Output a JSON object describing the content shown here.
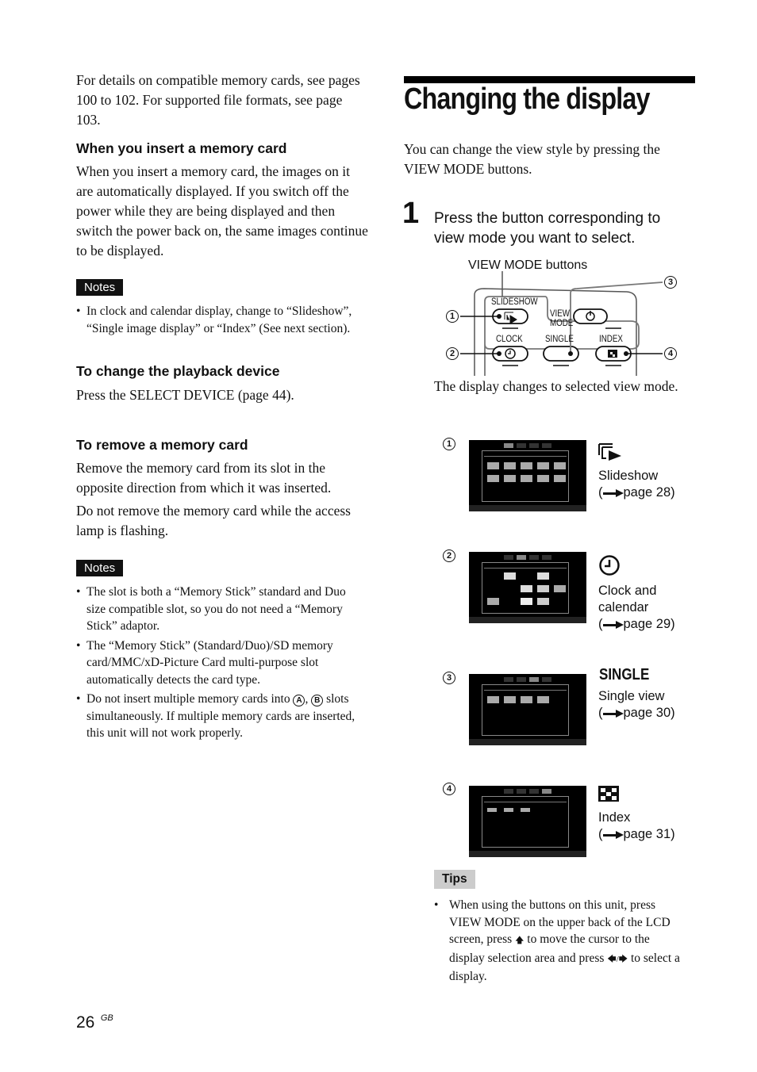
{
  "left": {
    "intro": "For details on compatible memory cards, see pages 100 to 102. For supported file formats, see page 103.",
    "section1": {
      "heading": "When you insert a memory card",
      "body": "When you insert a memory card, the images on it are automatically displayed. If you switch off the power while they are being displayed and then switch the power back on, the same images continue to be displayed."
    },
    "notes1": {
      "label": "Notes",
      "items": [
        "In clock and calendar display, change to “Slideshow”, “Single image display” or “Index” (See next section)."
      ]
    },
    "section2": {
      "heading": "To change the playback device",
      "body": "Press the SELECT DEVICE (page 44)."
    },
    "section3": {
      "heading": "To remove a memory card",
      "body1": "Remove the memory card from its slot in the opposite direction from which it was inserted.",
      "body2": "Do not remove the memory card while the access lamp is flashing."
    },
    "notes2": {
      "label": "Notes",
      "items": [
        "The slot is both a “Memory Stick” standard and Duo size compatible slot, so you do not need a “Memory Stick” adaptor.",
        "The “Memory Stick” (Standard/Duo)/SD memory card/MMC/xD-Picture Card multi-purpose slot automatically detects the card type.",
        "Do not insert multiple memory cards into",
        "slots simultaneously. If multiple memory cards are inserted, this unit will not work properly."
      ],
      "slot_a": "A",
      "slot_b": "B"
    }
  },
  "right": {
    "title": "Changing the display",
    "intro": "You can change the view style by pressing the VIEW MODE buttons.",
    "step": {
      "number": "1",
      "text": "Press the button corresponding to view mode you want to select."
    },
    "diagram": {
      "caption": "VIEW MODE buttons",
      "buttons": {
        "slideshow": "SLIDESHOW",
        "view_mode_1": "VIEW",
        "view_mode_2": "MODE",
        "clock": "CLOCK",
        "single": "SINGLE",
        "index": "INDEX"
      },
      "callouts": [
        "1",
        "2",
        "3",
        "4"
      ]
    },
    "result_text": "The display changes to selected view mode.",
    "modes": [
      {
        "num": "1",
        "icon": "slideshow-icon",
        "label": "Slideshow",
        "page": "page 28)"
      },
      {
        "num": "2",
        "icon": "clock-icon",
        "label1": "Clock and",
        "label2": "calendar",
        "page": "page 29)"
      },
      {
        "num": "3",
        "icon_text": "SINGLE",
        "label": "Single view",
        "page": "page 30)"
      },
      {
        "num": "4",
        "icon": "index-icon",
        "label": "Index",
        "page": "page 31)"
      }
    ],
    "tips": {
      "label": "Tips",
      "text_a": "When using the buttons on this unit, press VIEW MODE on the upper back of the LCD screen, press",
      "text_b": "to move the cursor to the display selection area and press",
      "text_c": "to select a display.",
      "up_arrow": "🡅",
      "lr_arrows": "🡄/🡆"
    }
  },
  "footer": {
    "page_number": "26",
    "region": "GB"
  },
  "paren_open": "("
}
